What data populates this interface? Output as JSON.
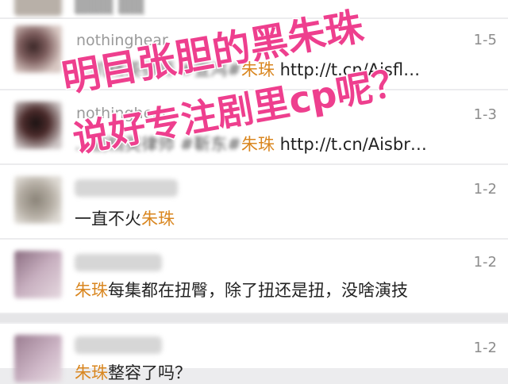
{
  "comments": [
    {
      "user": "",
      "pre": "",
      "keyword": "",
      "post": "",
      "link": "",
      "date": ""
    },
    {
      "user": "nothinghear",
      "pre": "…机精英律师 #宣鸿#",
      "keyword": "朱珠",
      "post": " ",
      "link": "http://t.cn/Aisfl…",
      "date": "1-5"
    },
    {
      "user": "nothinghear",
      "pre": "…剧精英律师 #靳东#",
      "keyword": "朱珠",
      "post": " ",
      "link": "http://t.cn/Aisbr…",
      "date": "1-3"
    },
    {
      "user": "",
      "pre": "一直不火",
      "keyword": "朱珠",
      "post": "",
      "link": "",
      "date": "1-2"
    },
    {
      "user": "",
      "pre": "",
      "keyword": "朱珠",
      "post": "每集都在扭臀，除了扭还是扭，没啥演技",
      "link": "",
      "date": "1-2"
    },
    {
      "user": "",
      "pre": "",
      "keyword": "朱珠",
      "post": "整容了吗？",
      "link": "",
      "date": "1-2"
    }
  ],
  "overlay": {
    "line1": "明目张胆的黑朱珠",
    "line2": "说好专注剧里cp呢？"
  },
  "colors": {
    "keyword": "#d9861f",
    "overlay": "#ee3f8e"
  }
}
